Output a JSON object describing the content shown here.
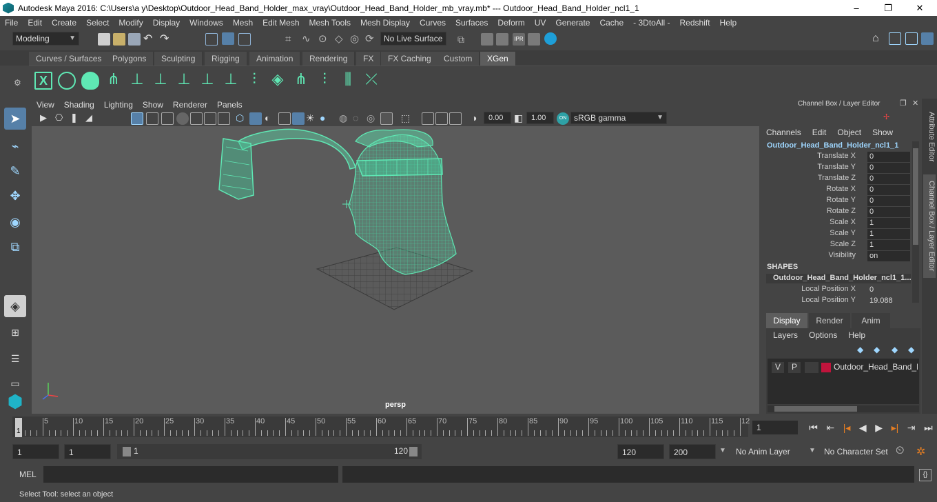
{
  "window": {
    "title": "Autodesk Maya 2016: C:\\Users\\a y\\Desktop\\Outdoor_Head_Band_Holder_max_vray\\Outdoor_Head_Band_Holder_mb_vray.mb*   ---   Outdoor_Head_Band_Holder_ncl1_1",
    "minimize": "–",
    "maximize": "❐",
    "close": "✕"
  },
  "menubar": [
    "File",
    "Edit",
    "Create",
    "Select",
    "Modify",
    "Display",
    "Windows",
    "Mesh",
    "Edit Mesh",
    "Mesh Tools",
    "Mesh Display",
    "Curves",
    "Surfaces",
    "Deform",
    "UV",
    "Generate",
    "Cache",
    "- 3DtoAll -",
    "Redshift",
    "Help"
  ],
  "statusline": {
    "mode": "Modeling",
    "live_surface": "No Live Surface"
  },
  "shelf": {
    "tabs": [
      "Curves / Surfaces",
      "Polygons",
      "Sculpting",
      "Rigging",
      "Animation",
      "Rendering",
      "FX",
      "FX Caching",
      "Custom",
      "XGen"
    ],
    "active_tab": "XGen"
  },
  "viewport": {
    "menu": [
      "View",
      "Shading",
      "Lighting",
      "Show",
      "Renderer",
      "Panels"
    ],
    "exposure": "0.00",
    "gamma": "1.00",
    "color_space": "sRGB gamma",
    "camera": "persp",
    "wire_color": "#5fe8b4"
  },
  "channel_box": {
    "header": "Channel Box / Layer Editor",
    "menu": [
      "Channels",
      "Edit",
      "Object",
      "Show"
    ],
    "object": "Outdoor_Head_Band_Holder_ncl1_1",
    "attributes": [
      {
        "label": "Translate X",
        "value": "0"
      },
      {
        "label": "Translate Y",
        "value": "0"
      },
      {
        "label": "Translate Z",
        "value": "0"
      },
      {
        "label": "Rotate X",
        "value": "0"
      },
      {
        "label": "Rotate Y",
        "value": "0"
      },
      {
        "label": "Rotate Z",
        "value": "0"
      },
      {
        "label": "Scale X",
        "value": "1"
      },
      {
        "label": "Scale Y",
        "value": "1"
      },
      {
        "label": "Scale Z",
        "value": "1"
      },
      {
        "label": "Visibility",
        "value": "on"
      }
    ],
    "shapes_title": "SHAPES",
    "shape_name": "Outdoor_Head_Band_Holder_ncl1_1...",
    "shape_attrs": [
      {
        "label": "Local Position X",
        "value": "0"
      },
      {
        "label": "Local Position Y",
        "value": "19.088"
      }
    ]
  },
  "layer_editor": {
    "tabs": [
      "Display",
      "Render",
      "Anim"
    ],
    "active_tab": "Display",
    "menu": [
      "Layers",
      "Options",
      "Help"
    ],
    "layer": {
      "v": "V",
      "p": "P",
      "name": "Outdoor_Head_Band_Ho",
      "color": "#c0143c"
    }
  },
  "side_tabs": [
    "Attribute Editor",
    "Channel Box / Layer Editor"
  ],
  "timeline": {
    "ticks": [
      "5",
      "10",
      "15",
      "20",
      "25",
      "30",
      "35",
      "40",
      "45",
      "50",
      "55",
      "60",
      "65",
      "70",
      "75",
      "80",
      "85",
      "90",
      "95",
      "100",
      "105",
      "110",
      "115",
      "12"
    ],
    "current_frame_marker": "1",
    "current_frame": "1"
  },
  "range": {
    "start": "1",
    "inner_start": "1",
    "slider_start": "1",
    "slider_end": "120",
    "end": "120",
    "outer_end": "200",
    "anim_layer": "No Anim Layer",
    "char_set": "No Character Set"
  },
  "cmdline": {
    "label": "MEL"
  },
  "helpline": "Select Tool: select an object"
}
